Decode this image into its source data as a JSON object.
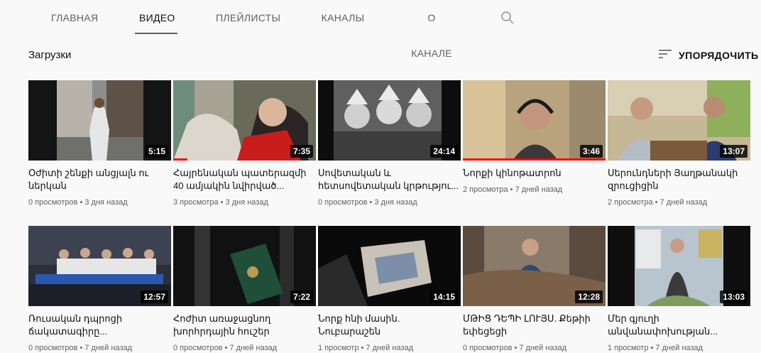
{
  "tabs": [
    {
      "label": "ГЛАВНАЯ"
    },
    {
      "label": "ВИДЕО"
    },
    {
      "label": "ПЛЕЙЛИСТЫ"
    },
    {
      "label": "КАНАЛЫ"
    },
    {
      "label": "О КАНАЛЕ"
    }
  ],
  "section": {
    "title": "Загрузки",
    "sort_label": "УПОРЯДОЧИТЬ"
  },
  "colors": {
    "accent": "#ff0000",
    "text": "#0f0f0f",
    "meta": "#606060"
  },
  "videos": [
    {
      "title": "Օժիտի շենքի անցյալն ու ներկան",
      "meta": "0 просмотров • 3 дня назад",
      "duration": "5:15",
      "watched": 0
    },
    {
      "title": "Հայրենական պատերազմի 40 ամյակին նվիրված...",
      "meta": "3 просмотра • 3 дня назад",
      "duration": "7:35",
      "watched": 0.1
    },
    {
      "title": "Սովետական և հետսովետական կրթությու...",
      "meta": "0 просмотров • 3 дня назад",
      "duration": "24:14",
      "watched": 0
    },
    {
      "title": "Նորքի կինոթատրոն",
      "meta": "2 просмотра • 7 дней назад",
      "duration": "3:46",
      "watched": 1
    },
    {
      "title": "Սերունդների Յաղթանակի զրուցիցին",
      "meta": "2 просмотра • 7 дней назад",
      "duration": "13:07",
      "watched": 0
    },
    {
      "title": "Ռուսական դպրոցի ճակատագիրը...",
      "meta": "0 просмотров • 7 дней назад",
      "duration": "12:57",
      "watched": 0
    },
    {
      "title": "Հոժիտ առաջացնող խորհրդային հուշեր",
      "meta": "0 просмотров • 7 дней назад",
      "duration": "7:22",
      "watched": 0
    },
    {
      "title": "Նորք հնի մասին. Նուբարաշեն",
      "meta": "1 просмотр • 7 дней назад",
      "duration": "14:15",
      "watched": 0
    },
    {
      "title": "ՄԹԻՑ ԴԵՊԻ ԼՈՒՅՍ. Քեթիի եփեցեցի",
      "meta": "0 просмотров • 7 дней назад",
      "duration": "12:28",
      "watched": 0
    },
    {
      "title": "Մեր գյուղի անվանափոխության...",
      "meta": "1 просмотр • 7 дней назад",
      "duration": "13:03",
      "watched": 0
    }
  ]
}
